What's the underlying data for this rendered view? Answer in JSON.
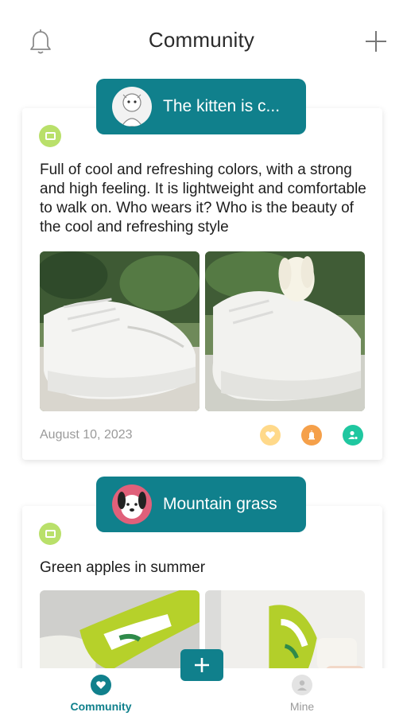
{
  "header": {
    "title": "Community",
    "left_icon": "bell-icon",
    "right_icon": "plus-icon"
  },
  "posts": [
    {
      "author": "The kitten is c...",
      "category_icon": "category-icon",
      "text": "Full of cool and refreshing colors, with a strong and high feeling. It is lightweight and comfortable to walk on. Who wears it? Who is the beauty of the cool and refreshing style",
      "images": [
        "white-sneakers-photo",
        "white-sneakers-photo"
      ],
      "date": "August 10, 2023",
      "actions": [
        "like-icon",
        "report-icon",
        "follow-icon"
      ]
    },
    {
      "author": "Mountain grass",
      "category_icon": "category-icon",
      "text": "Green apples in summer",
      "images": [
        "green-sneakers-photo",
        "green-sneakers-photo"
      ]
    }
  ],
  "bottom_nav": {
    "items": [
      {
        "label": "Community",
        "icon": "community-icon",
        "active": true
      },
      {
        "label": "Mine",
        "icon": "profile-icon",
        "active": false
      }
    ],
    "fab_icon": "plus-icon"
  },
  "colors": {
    "accent": "#10808c",
    "badge_green": "#b9e06a",
    "like": "#ffd98a",
    "report": "#f5a04a",
    "follow": "#1fc7a0"
  }
}
